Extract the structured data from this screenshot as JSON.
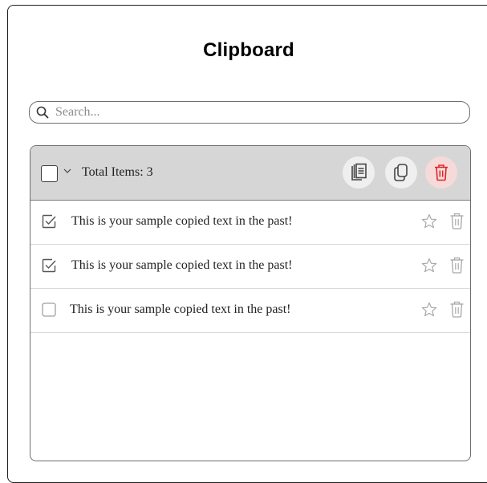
{
  "app": {
    "title": "Clipboard"
  },
  "search": {
    "placeholder": "Search..."
  },
  "list_header": {
    "total_label": "Total Items: 3",
    "actions": [
      "copy-all-icon",
      "copy-icon",
      "trash-icon"
    ],
    "delete_color": "#e02424",
    "delete_bg": "#f6dada"
  },
  "items": [
    {
      "text": "This is your sample copied text in the past!",
      "checked": true,
      "favorite": false
    },
    {
      "text": "This is your sample copied text in the past!",
      "checked": true,
      "favorite": false
    },
    {
      "text": "This is your sample copied text in the past!",
      "checked": false,
      "favorite": false
    }
  ]
}
